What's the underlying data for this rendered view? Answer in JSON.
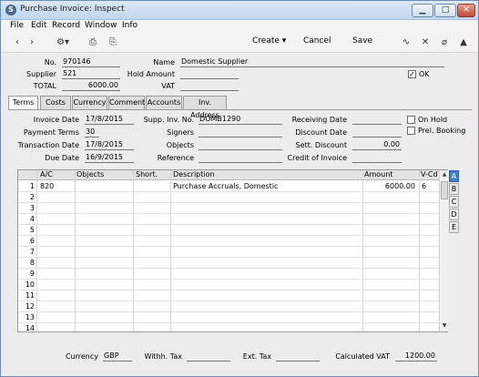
{
  "window": {
    "title": "Purchase Invoice: Inspect",
    "icon": "app-logo-icon"
  },
  "menu": [
    "File",
    "Edit",
    "Record",
    "Window",
    "Info"
  ],
  "toolbar": {
    "create_label": "Create",
    "cancel_label": "Cancel",
    "save_label": "Save"
  },
  "header": {
    "no_label": "No.",
    "no_value": "970146",
    "name_label": "Name",
    "name_value": "Domestic Supplier",
    "supplier_label": "Supplier",
    "supplier_value": "521",
    "hold_amount_label": "Hold Amount",
    "hold_amount_value": "",
    "ok_label": "OK",
    "ok_checked": true,
    "total_label": "TOTAL",
    "total_value": "6000.00",
    "vat_label": "VAT",
    "vat_value": ""
  },
  "tabs": [
    "Terms",
    "Costs",
    "Currency",
    "Comment",
    "Accounts",
    "Inv. Address"
  ],
  "active_tab": "Terms",
  "terms": {
    "invoice_date_label": "Invoice Date",
    "invoice_date": "17/8/2015",
    "payment_terms_label": "Payment Terms",
    "payment_terms": "30",
    "transaction_date_label": "Transaction Date",
    "transaction_date": "17/8/2015",
    "due_date_label": "Due Date",
    "due_date": "16/9/2015",
    "supp_inv_no_label": "Supp. Inv. No.",
    "supp_inv_no": "DOMB1290",
    "signers_label": "Signers",
    "signers": "",
    "objects_label": "Objects",
    "objects": "",
    "reference_label": "Reference",
    "reference": "",
    "receiving_date_label": "Receiving Date",
    "receiving_date": "",
    "discount_date_label": "Discount Date",
    "discount_date": "",
    "sett_discount_label": "Sett. Discount",
    "sett_discount": "0.00",
    "credit_of_invoice_label": "Credit of Invoice",
    "credit_of_invoice": "",
    "on_hold_label": "On Hold",
    "prel_booking_label": "Prel. Booking"
  },
  "grid": {
    "columns": [
      "A/C",
      "Objects",
      "Short.",
      "Description",
      "Amount",
      "V-Cd"
    ],
    "rows": [
      {
        "n": "1",
        "ac": "820",
        "objects": "",
        "short": "",
        "description": "Purchase Accruals, Domestic",
        "amount": "6000.00",
        "vcd": "6"
      },
      {
        "n": "2"
      },
      {
        "n": "3"
      },
      {
        "n": "4"
      },
      {
        "n": "5"
      },
      {
        "n": "6"
      },
      {
        "n": "7"
      },
      {
        "n": "8"
      },
      {
        "n": "9"
      },
      {
        "n": "10"
      },
      {
        "n": "11"
      },
      {
        "n": "12"
      },
      {
        "n": "13"
      },
      {
        "n": "14"
      }
    ],
    "side_tabs": [
      "A",
      "B",
      "C",
      "D",
      "E"
    ],
    "active_side_tab": "A"
  },
  "footer": {
    "currency_label": "Currency",
    "currency": "GBP",
    "withh_tax_label": "Withh. Tax",
    "withh_tax": "",
    "ext_tax_label": "Ext. Tax",
    "ext_tax": "",
    "calculated_vat_label": "Calculated VAT",
    "calculated_vat": "1200.00"
  }
}
